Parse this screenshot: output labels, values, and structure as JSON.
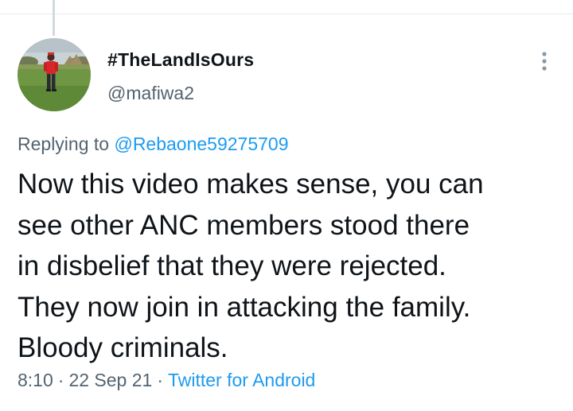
{
  "tweet": {
    "author": {
      "display_name": "#TheLandIsOurs",
      "handle": "@mafiwa2",
      "avatar": "person-in-red-shirt-on-grass-photo"
    },
    "more_icon": "more-vertical-icon",
    "replying_prefix": "Replying to",
    "replying_to": "@Rebaone59275709",
    "text_lines": [
      "Now this video makes sense, you can",
      "see other ANC members stood there",
      "in disbelief that they were rejected.",
      "They now join in attacking the family.",
      "Bloody criminals."
    ],
    "time": "8:10",
    "date": "22 Sep 21",
    "separator": "·",
    "source": "Twitter for Android"
  },
  "colors": {
    "text": "#0f1419",
    "secondary": "#536471",
    "link": "#1d9bf0",
    "divider": "#e8ebee",
    "thread_line": "#cfd9de"
  }
}
